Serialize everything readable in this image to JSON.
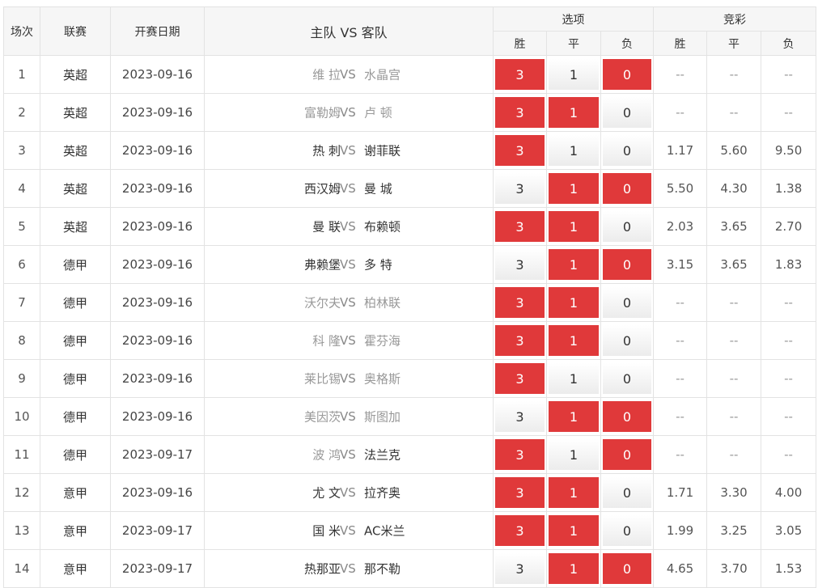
{
  "headers": {
    "round": "场次",
    "league": "联赛",
    "date": "开赛日期",
    "teams": "主队 VS 客队",
    "options": "选项",
    "lottery": "竞彩",
    "win": "胜",
    "draw": "平",
    "lose": "负"
  },
  "vs_label": "VS",
  "rows": [
    {
      "no": "1",
      "league": "英超",
      "date": "2023-09-16",
      "home": "维 拉",
      "away": "水晶宫",
      "home_faded": true,
      "away_faded": true,
      "sel": [
        true,
        false,
        true
      ],
      "odds": [
        "--",
        "--",
        "--"
      ]
    },
    {
      "no": "2",
      "league": "英超",
      "date": "2023-09-16",
      "home": "富勒姆",
      "away": "卢 顿",
      "home_faded": true,
      "away_faded": true,
      "sel": [
        true,
        true,
        false
      ],
      "odds": [
        "--",
        "--",
        "--"
      ]
    },
    {
      "no": "3",
      "league": "英超",
      "date": "2023-09-16",
      "home": "热 刺",
      "away": "谢菲联",
      "home_faded": false,
      "away_faded": false,
      "sel": [
        true,
        false,
        false
      ],
      "odds": [
        "1.17",
        "5.60",
        "9.50"
      ]
    },
    {
      "no": "4",
      "league": "英超",
      "date": "2023-09-16",
      "home": "西汉姆",
      "away": "曼 城",
      "home_faded": false,
      "away_faded": false,
      "sel": [
        false,
        true,
        true
      ],
      "odds": [
        "5.50",
        "4.30",
        "1.38"
      ]
    },
    {
      "no": "5",
      "league": "英超",
      "date": "2023-09-16",
      "home": "曼 联",
      "away": "布赖顿",
      "home_faded": false,
      "away_faded": false,
      "sel": [
        true,
        true,
        false
      ],
      "odds": [
        "2.03",
        "3.65",
        "2.70"
      ]
    },
    {
      "no": "6",
      "league": "德甲",
      "date": "2023-09-16",
      "home": "弗赖堡",
      "away": "多 特",
      "home_faded": false,
      "away_faded": false,
      "sel": [
        false,
        true,
        true
      ],
      "odds": [
        "3.15",
        "3.65",
        "1.83"
      ]
    },
    {
      "no": "7",
      "league": "德甲",
      "date": "2023-09-16",
      "home": "沃尔夫",
      "away": "柏林联",
      "home_faded": true,
      "away_faded": true,
      "sel": [
        true,
        true,
        false
      ],
      "odds": [
        "--",
        "--",
        "--"
      ]
    },
    {
      "no": "8",
      "league": "德甲",
      "date": "2023-09-16",
      "home": "科 隆",
      "away": "霍芬海",
      "home_faded": true,
      "away_faded": true,
      "sel": [
        true,
        true,
        false
      ],
      "odds": [
        "--",
        "--",
        "--"
      ]
    },
    {
      "no": "9",
      "league": "德甲",
      "date": "2023-09-16",
      "home": "莱比锡",
      "away": "奥格斯",
      "home_faded": true,
      "away_faded": true,
      "sel": [
        true,
        false,
        false
      ],
      "odds": [
        "--",
        "--",
        "--"
      ]
    },
    {
      "no": "10",
      "league": "德甲",
      "date": "2023-09-16",
      "home": "美因茨",
      "away": "斯图加",
      "home_faded": true,
      "away_faded": true,
      "sel": [
        false,
        true,
        true
      ],
      "odds": [
        "--",
        "--",
        "--"
      ]
    },
    {
      "no": "11",
      "league": "德甲",
      "date": "2023-09-17",
      "home": "波 鸿",
      "away": "法兰克",
      "home_faded": true,
      "away_faded": false,
      "sel": [
        true,
        false,
        true
      ],
      "odds": [
        "--",
        "--",
        "--"
      ]
    },
    {
      "no": "12",
      "league": "意甲",
      "date": "2023-09-16",
      "home": "尤 文",
      "away": "拉齐奥",
      "home_faded": false,
      "away_faded": false,
      "sel": [
        true,
        true,
        false
      ],
      "odds": [
        "1.71",
        "3.30",
        "4.00"
      ]
    },
    {
      "no": "13",
      "league": "意甲",
      "date": "2023-09-17",
      "home": "国 米",
      "away": "AC米兰",
      "home_faded": false,
      "away_faded": false,
      "sel": [
        true,
        true,
        false
      ],
      "odds": [
        "1.99",
        "3.25",
        "3.05"
      ]
    },
    {
      "no": "14",
      "league": "意甲",
      "date": "2023-09-17",
      "home": "热那亚",
      "away": "那不勒",
      "home_faded": false,
      "away_faded": false,
      "sel": [
        false,
        true,
        true
      ],
      "odds": [
        "4.65",
        "3.70",
        "1.53"
      ]
    }
  ],
  "option_values": [
    "3",
    "1",
    "0"
  ],
  "colors": {
    "selected": "#e0393a",
    "header_bg": "#f6f6f6",
    "border": "#e3e3e3"
  }
}
